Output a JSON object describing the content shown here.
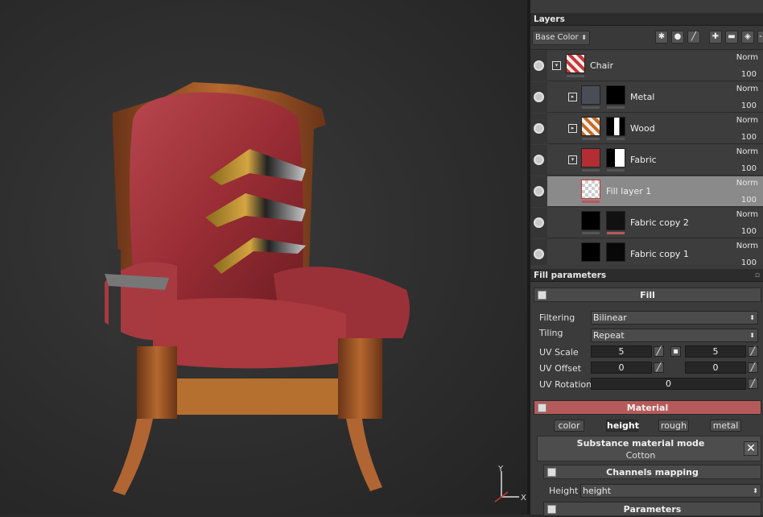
{
  "viewport": {
    "axis_y": "Y",
    "axis_x": "X"
  },
  "layers_panel": {
    "title": "Layers",
    "grip": "▫",
    "channel": "Base Color",
    "toolbar_icons": [
      "mask-icon",
      "circle-icon",
      "paint-icon",
      "add-icon",
      "folder-icon",
      "fill-icon",
      "more-icon"
    ],
    "rows": [
      {
        "name": "Chair",
        "blend": "Norm",
        "opacity": "100",
        "type": "folder-open"
      },
      {
        "name": "Metal",
        "blend": "Norm",
        "opacity": "100",
        "type": "folder-closed"
      },
      {
        "name": "Wood",
        "blend": "Norm",
        "opacity": "100",
        "type": "folder-closed"
      },
      {
        "name": "Fabric",
        "blend": "Norm",
        "opacity": "100",
        "type": "folder-open"
      },
      {
        "name": "Fill layer 1",
        "blend": "Norm",
        "opacity": "100",
        "type": "fill",
        "selected": true
      },
      {
        "name": "Fabric copy 2",
        "blend": "Norm",
        "opacity": "100",
        "type": "layer"
      },
      {
        "name": "Fabric copy 1",
        "blend": "Norm",
        "opacity": "100",
        "type": "layer"
      }
    ]
  },
  "fill_panel": {
    "title": "Fill parameters",
    "fill_section": "Fill",
    "filtering_label": "Filtering",
    "filtering_value": "Bilinear",
    "tiling_label": "Tiling",
    "tiling_value": "Repeat",
    "uv_scale_label": "UV Scale",
    "uv_scale_u": "5",
    "uv_scale_v": "5",
    "uv_offset_label": "UV Offset",
    "uv_offset_u": "0",
    "uv_offset_v": "0",
    "uv_rotation_label": "UV Rotation",
    "uv_rotation_value": "0",
    "material_section": "Material",
    "material_tabs": [
      "color",
      "height",
      "rough",
      "metal"
    ],
    "active_tab": "height",
    "substance_mode_title": "Substance material mode",
    "substance_mode_value": "Cotton",
    "close_glyph": "✕",
    "channels_mapping": "Channels mapping",
    "height_label": "Height",
    "height_value": "height",
    "parameters_section": "Parameters"
  },
  "colors": {
    "accent_material": "#b55a5a",
    "panel_bg": "#3b3b3b",
    "selected_row": "#8a8a8a",
    "fabric_red": "#a8353c"
  }
}
